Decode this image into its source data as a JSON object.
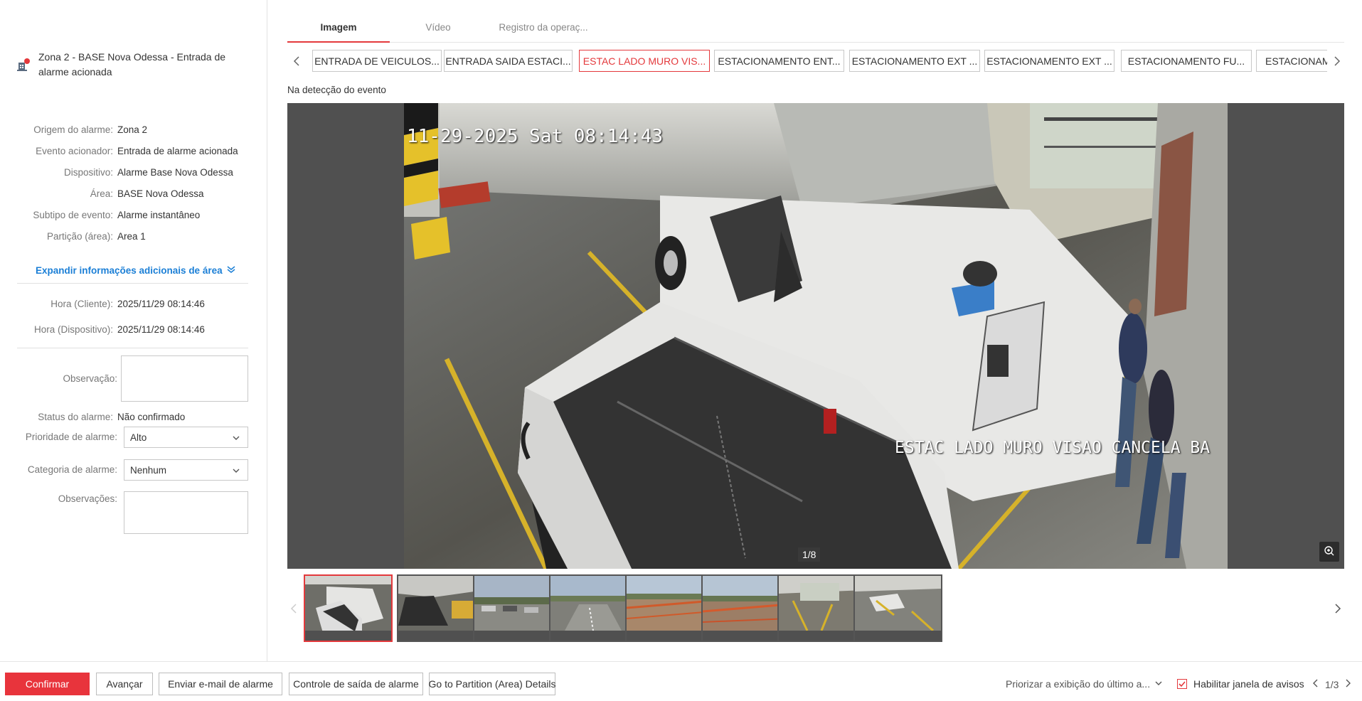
{
  "alarm": {
    "title": "Zona 2 - BASE Nova Odessa - Entrada de alarme acionada"
  },
  "details": [
    {
      "label": "Origem do alarme:",
      "value": "Zona 2"
    },
    {
      "label": "Evento acionador:",
      "value": "Entrada de alarme acionada"
    },
    {
      "label": "Dispositivo:",
      "value": "Alarme Base Nova Odessa"
    },
    {
      "label": "Área:",
      "value": "BASE Nova Odessa"
    },
    {
      "label": "Subtipo de evento:",
      "value": "Alarme instantâneo"
    },
    {
      "label": "Partição (área):",
      "value": "Area 1"
    }
  ],
  "expand_label": "Expandir informações adicionais de área",
  "times": [
    {
      "label": "Hora (Cliente):",
      "value": "2025/11/29 08:14:46"
    },
    {
      "label": "Hora (Dispositivo):",
      "value": "2025/11/29 08:14:46"
    }
  ],
  "form": {
    "observation_label": "Observação:",
    "observation_value": "",
    "status_label": "Status do alarme:",
    "status_value": "Não confirmado",
    "priority_label": "Prioridade de alarme:",
    "priority_value": "Alto",
    "category_label": "Categoria de alarme:",
    "category_value": "Nenhum",
    "remarks_label": "Observações:",
    "remarks_value": ""
  },
  "tabs": [
    "Imagem",
    "Vídeo",
    "Registro da operaç..."
  ],
  "cameras": [
    "ENTRADA DE VEICULOS...",
    "ENTRADA SAIDA ESTACI...",
    "ESTAC LADO MURO VIS...",
    "ESTACIONAMENTO ENT...",
    "ESTACIONAMENTO EXT ...",
    "ESTACIONAMENTO EXT ...",
    "ESTACIONAMENTO FU...",
    "ESTACIONAM"
  ],
  "event_label": "Na detecção do evento",
  "image": {
    "osd_time": "11-29-2025 Sat 08:14:43",
    "osd_name": "ESTAC LADO MURO VISAO CANCELA BA",
    "counter": "1/8"
  },
  "footer": {
    "confirm": "Confirmar",
    "next": "Avançar",
    "email": "Enviar e-mail de alarme",
    "output": "Controle de saída de alarme",
    "partition": "Go to Partition (Area) Details",
    "prioritize": "Priorizar a exibição do último a...",
    "enable_popup": "Habilitar janela de avisos",
    "pager": "1/3"
  },
  "colors": {
    "accent": "#e4393c",
    "link": "#1b7fd6"
  }
}
